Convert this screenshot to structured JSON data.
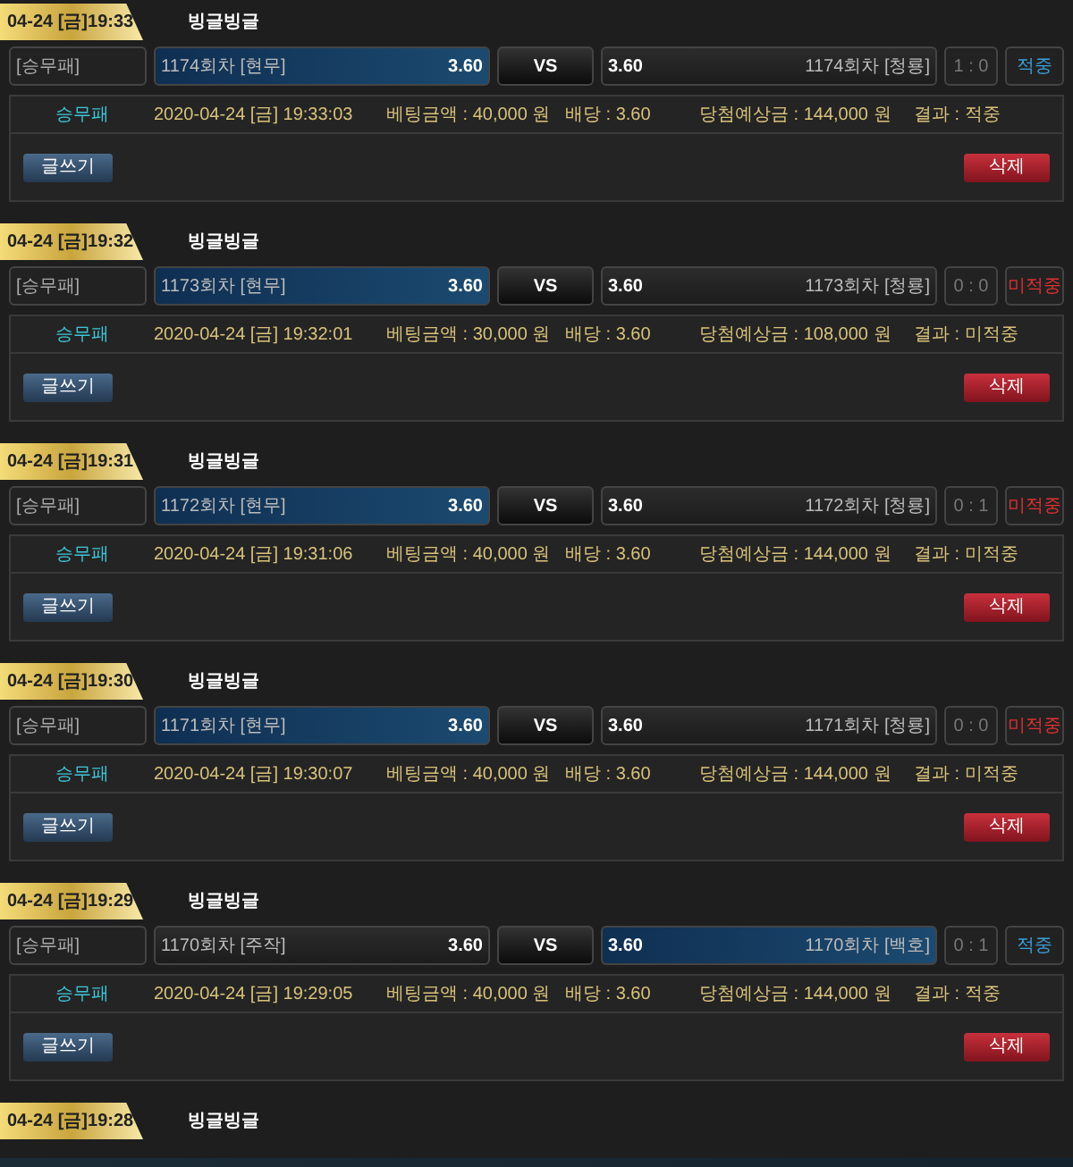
{
  "bets": [
    {
      "time": "04-24 [금]19:33",
      "title": "빙글빙글",
      "category": "[승무패]",
      "home": {
        "label": "1174회차 [현무]",
        "odds": "3.60",
        "selected": true
      },
      "vs": "VS",
      "away": {
        "label": "1174회차 [청룡]",
        "odds": "3.60",
        "selected": false
      },
      "score": "1 : 0",
      "result": "적중",
      "won": true,
      "details": [
        "승무패",
        "2020-04-24 [금] 19:33:03",
        "베팅금액 : 40,000 원",
        "배당 : 3.60",
        "당첨예상금 : 144,000 원",
        "결과 : 적중"
      ],
      "write_button": "글쓰기",
      "delete_button": "삭제"
    },
    {
      "time": "04-24 [금]19:32",
      "title": "빙글빙글",
      "category": "[승무패]",
      "home": {
        "label": "1173회차 [현무]",
        "odds": "3.60",
        "selected": true
      },
      "vs": "VS",
      "away": {
        "label": "1173회차 [청룡]",
        "odds": "3.60",
        "selected": false
      },
      "score": "0 : 0",
      "result": "미적중",
      "won": false,
      "details": [
        "승무패",
        "2020-04-24 [금] 19:32:01",
        "베팅금액 : 30,000 원",
        "배당 : 3.60",
        "당첨예상금 : 108,000 원",
        "결과 : 미적중"
      ],
      "write_button": "글쓰기",
      "delete_button": "삭제"
    },
    {
      "time": "04-24 [금]19:31",
      "title": "빙글빙글",
      "category": "[승무패]",
      "home": {
        "label": "1172회차 [현무]",
        "odds": "3.60",
        "selected": true
      },
      "vs": "VS",
      "away": {
        "label": "1172회차 [청룡]",
        "odds": "3.60",
        "selected": false
      },
      "score": "0 : 1",
      "result": "미적중",
      "won": false,
      "details": [
        "승무패",
        "2020-04-24 [금] 19:31:06",
        "베팅금액 : 40,000 원",
        "배당 : 3.60",
        "당첨예상금 : 144,000 원",
        "결과 : 미적중"
      ],
      "write_button": "글쓰기",
      "delete_button": "삭제"
    },
    {
      "time": "04-24 [금]19:30",
      "title": "빙글빙글",
      "category": "[승무패]",
      "home": {
        "label": "1171회차 [현무]",
        "odds": "3.60",
        "selected": true
      },
      "vs": "VS",
      "away": {
        "label": "1171회차 [청룡]",
        "odds": "3.60",
        "selected": false
      },
      "score": "0 : 0",
      "result": "미적중",
      "won": false,
      "details": [
        "승무패",
        "2020-04-24 [금] 19:30:07",
        "베팅금액 : 40,000 원",
        "배당 : 3.60",
        "당첨예상금 : 144,000 원",
        "결과 : 미적중"
      ],
      "write_button": "글쓰기",
      "delete_button": "삭제"
    },
    {
      "time": "04-24 [금]19:29",
      "title": "빙글빙글",
      "category": "[승무패]",
      "home": {
        "label": "1170회차 [주작]",
        "odds": "3.60",
        "selected": false
      },
      "vs": "VS",
      "away": {
        "label": "1170회차 [백호]",
        "odds": "3.60",
        "selected": true
      },
      "score": "0 : 1",
      "result": "적중",
      "won": true,
      "details": [
        "승무패",
        "2020-04-24 [금] 19:29:05",
        "베팅금액 : 40,000 원",
        "배당 : 3.60",
        "당첨예상금 : 144,000 원",
        "결과 : 적중"
      ],
      "write_button": "글쓰기",
      "delete_button": "삭제"
    },
    {
      "time": "04-24 [금]19:28",
      "title": "빙글빙글"
    }
  ]
}
